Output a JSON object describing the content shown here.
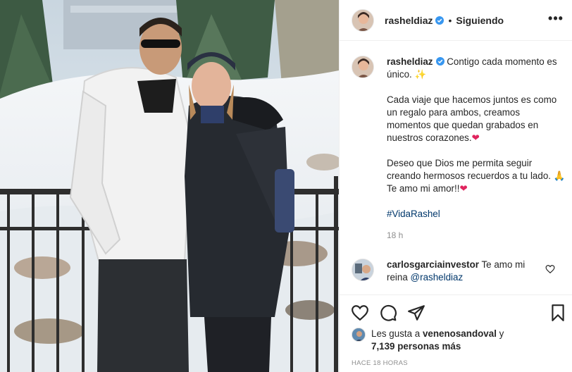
{
  "header": {
    "username": "rasheldiaz",
    "separator": "•",
    "follow_status": "Siguiendo",
    "more_label": "•••"
  },
  "caption": {
    "username": "rasheldiaz",
    "line1": "Contigo cada momento es único. ✨",
    "paragraph2": "Cada viaje que hacemos juntos es como un regalo para ambos, creamos momentos que quedan grabados en nuestros corazones.",
    "paragraph3": "Deseo que Dios me permita seguir creando hermosos recuerdos a tu lado. 🙏 Te amo mi amor!!",
    "heart": "❤",
    "hashtag": "#VidaRashel",
    "time": "18 h"
  },
  "comment": {
    "username": "carlosgarciainvestor",
    "text": "Te amo mi reina",
    "mention": "@rasheldiaz"
  },
  "likes": {
    "prefix": "Les gusta a",
    "user": "venenosandoval",
    "conj": "y",
    "count": "7,139 personas más"
  },
  "posted": "HACE 18 HORAS",
  "colors": {
    "verified": "#3897f0",
    "text": "#262626",
    "muted": "#8e8e8e",
    "link": "#00376b",
    "heart": "#e0245e"
  },
  "icons": [
    "heart-icon",
    "comment-icon",
    "share-icon",
    "bookmark-icon",
    "verified-icon",
    "more-icon"
  ]
}
